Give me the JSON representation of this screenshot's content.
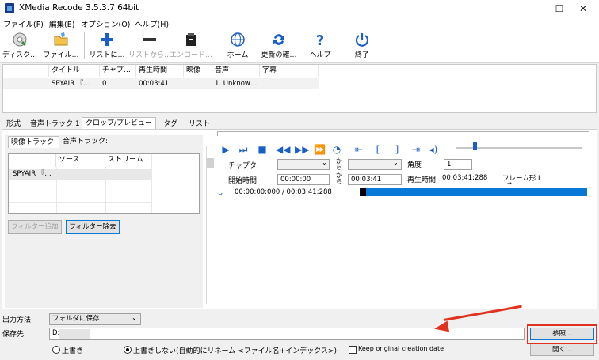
{
  "window": {
    "title": "XMedia Recode 3.5.3.7 64bit",
    "minimize": "—",
    "maximize": "☐",
    "close": "✕"
  },
  "menu": [
    "ファイル(F)",
    "編集(E)",
    "オプション(O)",
    "ヘルプ(H)"
  ],
  "toolbar": [
    {
      "label": "ディスク…",
      "icon": "disc-icon"
    },
    {
      "label": "ファイル…",
      "icon": "folder-icon"
    },
    {
      "label": "リストに…",
      "icon": "plus-icon"
    },
    {
      "label": "リストから…",
      "icon": "minus-icon"
    },
    {
      "label": "エンコード…",
      "icon": "encode-icon"
    },
    {
      "label": "ホーム",
      "icon": "globe-icon"
    },
    {
      "label": "更新の確…",
      "icon": "refresh-icon"
    },
    {
      "label": "ヘルプ",
      "icon": "help-icon"
    },
    {
      "label": "終了",
      "icon": "power-icon"
    }
  ],
  "filelist": {
    "headers": [
      "タイトル",
      "チャプ…",
      "再生時間",
      "映像",
      "音声",
      "字幕"
    ],
    "row": [
      "SPYAIR 『…",
      "0",
      "00:03:41",
      "",
      "1. Unknow…",
      ""
    ]
  },
  "tabs": [
    "形式",
    "音声トラック 1",
    "クロップ/プレビュー",
    "タグ",
    "リスト"
  ],
  "subtabs": [
    "映像トラック:",
    "音声トラック:"
  ],
  "tracklist": {
    "headers": [
      "",
      "ソース",
      "ストリーム"
    ],
    "row": "SPYAIR 『…"
  },
  "buttons": {
    "add_filter": "フィルター追加",
    "remove_filter": "フィルター除去",
    "browse": "参照...",
    "open": "開く..."
  },
  "preview": {
    "chapter_label": "チャプタ:",
    "from_label": "から",
    "angle_label": "角度",
    "angle_value": "1",
    "start_label": "開始時間",
    "start_value": "00:00:00",
    "to_label": "から",
    "end_value": "00:03:41",
    "duration_label": "再生時間:",
    "duration_value": "00:03:41:288",
    "frame_label": "フレーム形 I",
    "frame_label2": "→",
    "timecode": "00:00:00:000 / 00:03:41:288",
    "progress": 0.03
  },
  "output": {
    "method_label": "出力方法:",
    "method_value": "フォルダに保存",
    "dest_label": "保存先:",
    "dest_value": "D:\\",
    "overwrite": "上書き",
    "no_overwrite": "上書きしない(自動的にリネーム <ファイル名+インデックス>)",
    "keep_date": "Keep original creation date"
  }
}
